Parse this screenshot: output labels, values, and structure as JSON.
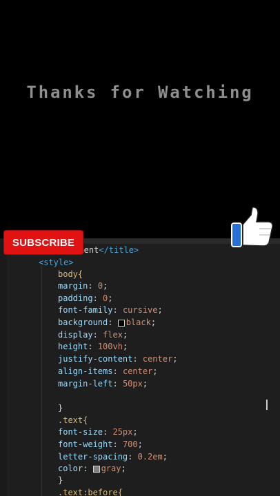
{
  "video": {
    "end_text": "Thanks for Watching",
    "subscribe_label": "SUBSCRIBE"
  },
  "code": {
    "title_line": {
      "fragment": "cument",
      "close_tag": "</title>"
    },
    "style_open": "<style>",
    "body_selector": "body{",
    "decls_body": [
      {
        "prop": "margin",
        "val": "0"
      },
      {
        "prop": "padding",
        "val": "0"
      },
      {
        "prop": "font-family",
        "val": "cursive"
      },
      {
        "prop": "background",
        "val": "black"
      },
      {
        "prop": "display",
        "val": "flex"
      },
      {
        "prop": "height",
        "val": "100vh"
      },
      {
        "prop": "justify-content",
        "val": "center"
      },
      {
        "prop": "align-items",
        "val": "center"
      },
      {
        "prop": "margin-left",
        "val": "50px"
      }
    ],
    "close_brace": "}",
    "text_selector": ".text{",
    "decls_text": [
      {
        "prop": "font-size",
        "val": "25px"
      },
      {
        "prop": "font-weight",
        "val": "700"
      },
      {
        "prop": "letter-spacing",
        "val": "0.2em"
      },
      {
        "prop": "color",
        "val": "gray"
      }
    ],
    "before_selector": ".text:before{"
  },
  "colors": {
    "subscribe_bg": "#e01212",
    "like_blue": "#2a6fd6",
    "editor_bg": "#1e1e1e"
  },
  "icons": [
    "thumbs-up-icon",
    "text-cursor-icon"
  ]
}
